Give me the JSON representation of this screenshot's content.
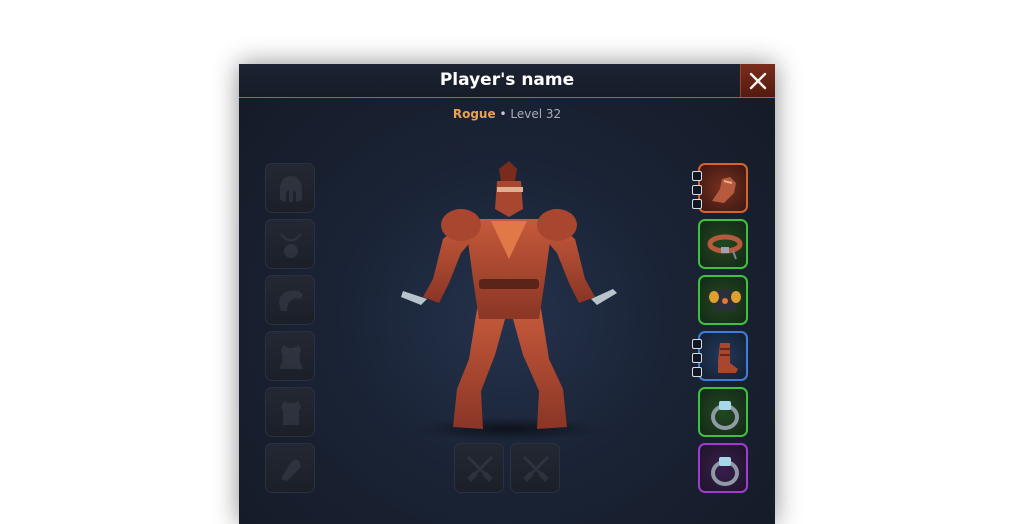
{
  "dialog": {
    "title": "Player's name",
    "close_icon": "close-icon"
  },
  "player": {
    "class_name": "Rogue",
    "separator": "•",
    "level_text": "Level 32"
  },
  "left_slots": [
    {
      "slot": "helmet",
      "icon": "helmet-icon",
      "state": "empty"
    },
    {
      "slot": "amulet",
      "icon": "amulet-icon",
      "state": "empty"
    },
    {
      "slot": "pauldrons",
      "icon": "shoulder-icon",
      "state": "empty"
    },
    {
      "slot": "cloak",
      "icon": "cloak-icon",
      "state": "empty"
    },
    {
      "slot": "armor",
      "icon": "armor-icon",
      "state": "empty"
    },
    {
      "slot": "gloves",
      "icon": "gloves-icon",
      "state": "empty"
    }
  ],
  "right_slots": [
    {
      "slot": "gloves",
      "icon": "glove-icon",
      "rarity_color": "#d8632c",
      "pips": 3
    },
    {
      "slot": "belt",
      "icon": "belt-icon",
      "rarity_color": "#3ec13e",
      "pips": 0
    },
    {
      "slot": "chest",
      "icon": "chest-armor-icon",
      "rarity_color": "#3ec13e",
      "pips": 0
    },
    {
      "slot": "boots",
      "icon": "boot-icon",
      "rarity_color": "#3e7ed8",
      "pips": 3
    },
    {
      "slot": "ring-1",
      "icon": "ring-icon",
      "rarity_color": "#3ec13e",
      "pips": 0
    },
    {
      "slot": "ring-2",
      "icon": "ring-icon",
      "rarity_color": "#a03ad0",
      "pips": 0
    }
  ],
  "weapon_slots": [
    {
      "slot": "main-hand",
      "icon": "crossed-daggers-icon",
      "state": "empty"
    },
    {
      "slot": "off-hand",
      "icon": "crossed-daggers-icon",
      "state": "empty"
    }
  ],
  "character": {
    "icon": "rogue-character-model"
  }
}
